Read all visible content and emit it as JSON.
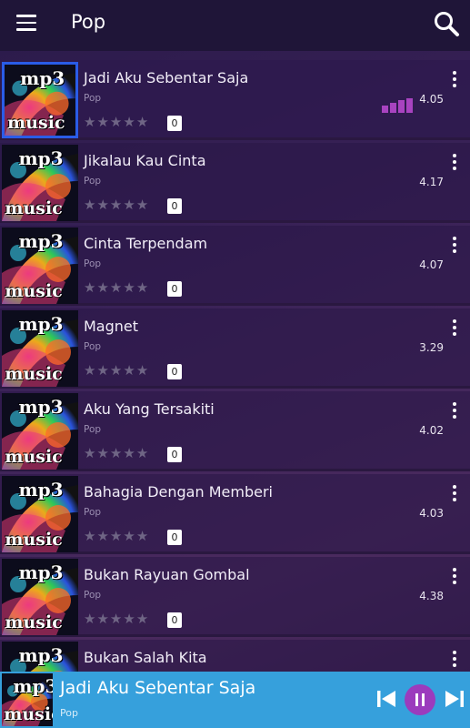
{
  "appbar": {
    "title": "Pop"
  },
  "songs": [
    {
      "title": "Jadi Aku Sebentar Saja",
      "genre": "Pop",
      "rating_count": "0",
      "duration": "4.05",
      "playing": true
    },
    {
      "title": "Jikalau Kau Cinta",
      "genre": "Pop",
      "rating_count": "0",
      "duration": "4.17",
      "playing": false
    },
    {
      "title": "Cinta Terpendam",
      "genre": "Pop",
      "rating_count": "0",
      "duration": "4.07",
      "playing": false
    },
    {
      "title": "Magnet",
      "genre": "Pop",
      "rating_count": "0",
      "duration": "3.29",
      "playing": false
    },
    {
      "title": "Aku Yang Tersakiti",
      "genre": "Pop",
      "rating_count": "0",
      "duration": "4.02",
      "playing": false
    },
    {
      "title": "Bahagia Dengan Memberi",
      "genre": "Pop",
      "rating_count": "0",
      "duration": "4.03",
      "playing": false
    },
    {
      "title": "Bukan Rayuan Gombal",
      "genre": "Pop",
      "rating_count": "0",
      "duration": "4.38",
      "playing": false
    },
    {
      "title": "Bukan Salah Kita",
      "genre": "Pop",
      "rating_count": "0",
      "duration": "",
      "playing": false
    }
  ],
  "thumbnail": {
    "line1": "mp3",
    "line2": "music"
  },
  "player": {
    "title": "Jadi Aku Sebentar Saja",
    "genre": "Pop"
  },
  "colors": {
    "accent": "#9b3bbd",
    "player_bar": "#36a0dc",
    "appbar": "#1f1538",
    "active_border": "#2a5ce8"
  },
  "icons": [
    "menu-icon",
    "search-icon",
    "more-vert-icon",
    "equalizer-icon",
    "star-icon",
    "skip-previous-icon",
    "pause-icon",
    "skip-next-icon"
  ]
}
